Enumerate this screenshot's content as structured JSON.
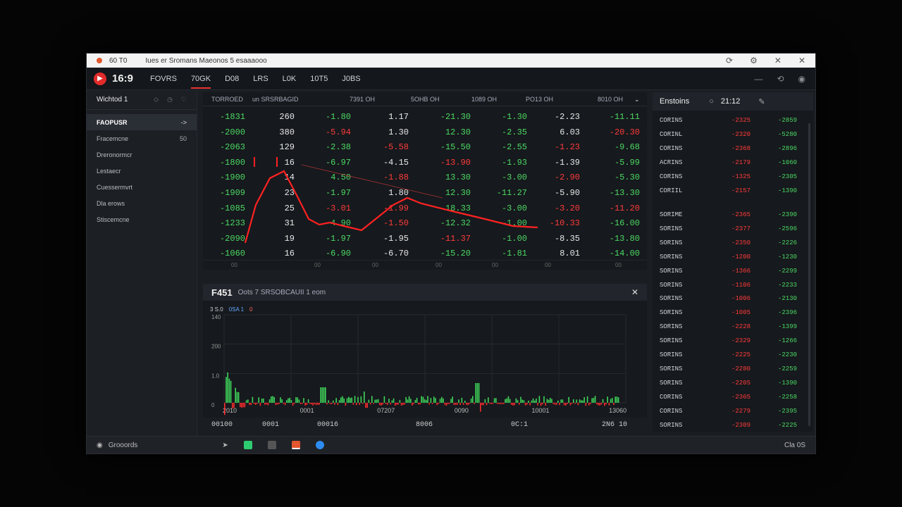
{
  "window": {
    "title_short": "60 T0",
    "title": "Iues er Sromans Maeonos 5 esaaaooo"
  },
  "app": {
    "title": "16:9",
    "tabs": [
      "FOVRS",
      "70GK",
      "D08",
      "LRS",
      "L0K",
      "10T5",
      "J0BS"
    ]
  },
  "sidebar": {
    "header": "Wichtod 1",
    "selected": {
      "label": "FAOPUSR",
      "arrow": "->"
    },
    "items": [
      {
        "label": "Fracemcne",
        "value": "50"
      },
      {
        "label": "Dreronormcr",
        "value": ""
      },
      {
        "label": "Lestaecr",
        "value": ""
      },
      {
        "label": "Cuessermvrt",
        "value": ""
      },
      {
        "label": "Dla erows",
        "value": ""
      },
      {
        "label": "Stiscemcne",
        "value": ""
      }
    ]
  },
  "table": {
    "header": {
      "c1": "TORROED",
      "c2": "un SRSRBAGID",
      "c3": "7391 OH",
      "c4": "5OHB OH",
      "c5": "1089 OH",
      "c6": "PO13 OH",
      "c7": "8010 OH"
    },
    "rows": [
      {
        "a": "-1831",
        "b": "260",
        "c": "-1.80",
        "d": "1.17",
        "e": "-21.30",
        "f": "-1.30",
        "g": "-2.23",
        "h": "-11.11"
      },
      {
        "a": "-2000",
        "b": "380",
        "c": "-5.94",
        "d": "1.30",
        "e": "12.30",
        "f": "-2.35",
        "g": "6.03",
        "h": "-20.30"
      },
      {
        "a": "-2063",
        "b": "129",
        "c": "-2.38",
        "d": "-5.58",
        "e": "-15.50",
        "f": "-2.55",
        "g": "-1.23",
        "h": "-9.68"
      },
      {
        "a": "-1800",
        "b": "16",
        "c": "-6.97",
        "d": "-4.15",
        "e": "-13.90",
        "f": "-1.93",
        "g": "-1.39",
        "h": "-5.99"
      },
      {
        "a": "-1900",
        "b": "14",
        "c": "4.50",
        "d": "-1.88",
        "e": "13.30",
        "f": "-3.00",
        "g": "-2.90",
        "h": "-5.30"
      },
      {
        "a": "-1909",
        "b": "23",
        "c": "-1.97",
        "d": "1.80",
        "e": "12.30",
        "f": "-11.27",
        "g": "-5.90",
        "h": "-13.30"
      },
      {
        "a": "-1085",
        "b": "25",
        "c": "-3.01",
        "d": "-1.99",
        "e": "18.33",
        "f": "-3.00",
        "g": "-3.20",
        "h": "-11.20"
      },
      {
        "a": "-1233",
        "b": "31",
        "c": "-4.90",
        "d": "-1.50",
        "e": "-12.32",
        "f": "-1.00",
        "g": "-10.33",
        "h": "-16.00"
      },
      {
        "a": "-2090",
        "b": "19",
        "c": "-1.97",
        "d": "-1.95",
        "e": "-11.37",
        "f": "-1.00",
        "g": "-8.35",
        "h": "-13.80"
      },
      {
        "a": "-1060",
        "b": "16",
        "c": "-6.90",
        "d": "-6.70",
        "e": "-15.20",
        "f": "-1.81",
        "g": "8.01",
        "h": "-14.00"
      }
    ],
    "footer": [
      "00",
      "00",
      "00",
      "00",
      "00",
      "00",
      "00"
    ]
  },
  "panel": {
    "title": "F451",
    "subtitle": "Oots 7 SRSOBCAUII 1 eom",
    "legend": [
      "3 S.0",
      "0SA 1",
      "0"
    ],
    "yticks": [
      "140",
      "200",
      "1.0",
      "0"
    ],
    "xticks_inner": [
      "2010",
      "0001",
      "07207",
      "0090",
      "10001",
      "13060"
    ],
    "xticks_outer": [
      "00100",
      "0001",
      "00016",
      "8006",
      "0C:1",
      "2N6 10"
    ]
  },
  "right": {
    "title": "Enstoins",
    "time": "21:12",
    "rows1": [
      {
        "n": "CORINS",
        "a": "-2325",
        "b": "-2859"
      },
      {
        "n": "CORINL",
        "a": "-2320",
        "b": "-5280"
      },
      {
        "n": "CORINS",
        "a": "-2368",
        "b": "-2896"
      },
      {
        "n": "ACRINS",
        "a": "-2179",
        "b": "-1060"
      },
      {
        "n": "CORINS",
        "a": "-1325",
        "b": "-2305"
      },
      {
        "n": "CORIIL",
        "a": "-2157",
        "b": "-1390"
      }
    ],
    "rows2": [
      {
        "n": "SORIME",
        "a": "-2365",
        "b": "-2390"
      },
      {
        "n": "SORINS",
        "a": "-2377",
        "b": "-2596"
      },
      {
        "n": "SORINS",
        "a": "-2350",
        "b": "-2226"
      },
      {
        "n": "SORINS",
        "a": "-1200",
        "b": "-1230"
      },
      {
        "n": "SORINS",
        "a": "-1366",
        "b": "-2299"
      },
      {
        "n": "SORINS",
        "a": "-1106",
        "b": "-2233"
      },
      {
        "n": "SORINS",
        "a": "-1006",
        "b": "-2130"
      },
      {
        "n": "SORINS",
        "a": "-1005",
        "b": "-2396"
      },
      {
        "n": "SORINS",
        "a": "-2228",
        "b": "-1399"
      },
      {
        "n": "SORINS",
        "a": "-2329",
        "b": "-1266"
      },
      {
        "n": "SORINS",
        "a": "-2225",
        "b": "-2230"
      },
      {
        "n": "SORINS",
        "a": "-2280",
        "b": "-2259"
      },
      {
        "n": "SORINS",
        "a": "-2205",
        "b": "-1390"
      },
      {
        "n": "CORINS",
        "a": "-2365",
        "b": "-2258"
      },
      {
        "n": "CORINS",
        "a": "-2279",
        "b": "-2395"
      },
      {
        "n": "SORINS",
        "a": "-2309",
        "b": "-2225"
      }
    ]
  },
  "status": {
    "label": "Grooords",
    "right": "Cla 0S"
  },
  "colors": {
    "up": "#4cd964",
    "down": "#ff3b3b",
    "accent": "#e32b2b"
  }
}
